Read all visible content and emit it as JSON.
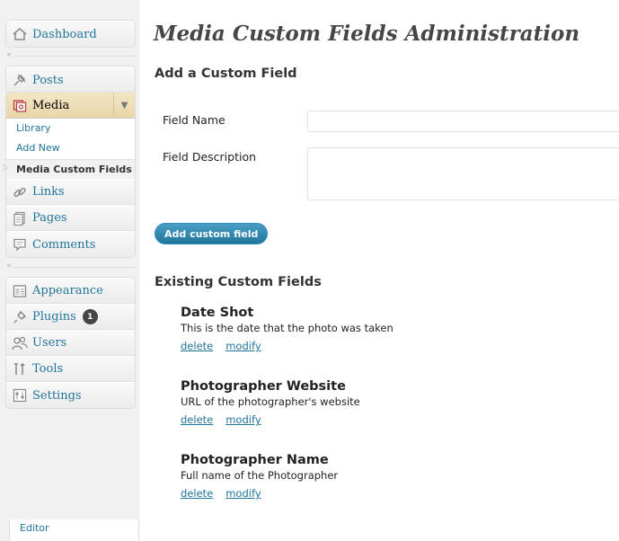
{
  "sidebar": {
    "dashboard": "Dashboard",
    "posts": "Posts",
    "media": {
      "label": "Media",
      "toggle_icon": "triangle-down-icon",
      "submenu": [
        "Library",
        "Add New"
      ],
      "current": "Media Custom Fields"
    },
    "links": "Links",
    "pages": "Pages",
    "comments": "Comments",
    "appearance": "Appearance",
    "plugins": "Plugins",
    "plugins_badge": "1",
    "users": "Users",
    "tools": "Tools",
    "settings": "Settings",
    "editor": "Editor",
    "collapse_icon": "«"
  },
  "main": {
    "title": "Media Custom Fields Administration",
    "add_section": {
      "title": "Add a Custom Field",
      "field_name_label": "Field Name",
      "field_name_value": "",
      "field_description_label": "Field Description",
      "field_description_value": "",
      "submit_label": "Add custom field"
    },
    "existing_section": {
      "title": "Existing Custom Fields",
      "delete_label": "delete",
      "modify_label": "modify",
      "fields": [
        {
          "name": "Date Shot",
          "description": "This is the date that the photo was taken"
        },
        {
          "name": "Photographer Website",
          "description": "URL of the photographer's website"
        },
        {
          "name": "Photographer Name",
          "description": "Full name of the Photographer"
        }
      ]
    }
  },
  "colors": {
    "link": "#21759b",
    "button": "#21759b",
    "media_active": "#ecdcb4"
  }
}
